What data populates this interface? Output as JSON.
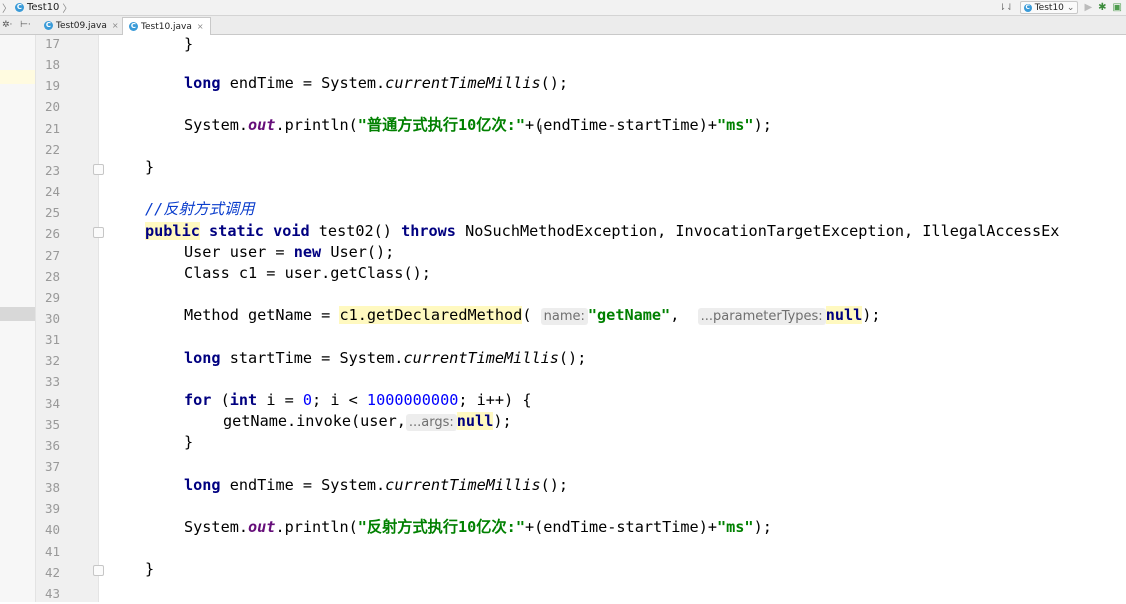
{
  "breadcrumb": {
    "label": "Test10"
  },
  "run_config": {
    "label": "Test10"
  },
  "tabs": [
    {
      "label": "Test09.java",
      "active": false
    },
    {
      "label": "Test10.java",
      "active": true
    }
  ],
  "code": {
    "line_numbers": [
      "17",
      "18",
      "19",
      "20",
      "21",
      "22",
      "23",
      "24",
      "25",
      "26",
      "27",
      "28",
      "29",
      "30",
      "31",
      "32",
      "33",
      "34",
      "35",
      "36",
      "37",
      "38",
      "39",
      "40",
      "41",
      "42",
      "43"
    ],
    "l17": {
      "brace": "}"
    },
    "l19": {
      "type": "long",
      "rest1": " endTime = System.",
      "method": "currentTimeMillis",
      "rest2": "();"
    },
    "l21": {
      "a": "System.",
      "field": "out",
      "b": ".println(",
      "str1": "\"普通方式执行10亿次:\"",
      "c": "+(endTime-startTime)+",
      "str2": "\"ms\"",
      "d": ");"
    },
    "l23": {
      "brace": "}"
    },
    "l25": {
      "slashes": "//",
      "comment": "反射方式调用"
    },
    "l26": {
      "kw1": "public",
      "kw2": "static",
      "kw3": "void",
      "name": " test02() ",
      "kw4": "throws",
      "rest": " NoSuchMethodException, InvocationTargetException, IllegalAccessEx"
    },
    "l27": {
      "a": "User user = ",
      "kw": "new",
      "b": " User();"
    },
    "l28": {
      "text": "Class c1 = user.getClass();"
    },
    "l30": {
      "a": "Method getName = ",
      "call": "c1.getDeclaredMethod",
      "b": "(",
      "hint1": "name:",
      "str": "\"getName\"",
      "c": ", ",
      "hint2": "...parameterTypes:",
      "kwnull": "null",
      "d": ");"
    },
    "l32": {
      "type": "long",
      "rest1": " startTime = System.",
      "method": "currentTimeMillis",
      "rest2": "();"
    },
    "l34": {
      "kw1": "for",
      "a": " (",
      "kw2": "int",
      "b": " i = ",
      "zero": "0",
      "c": "; i < ",
      "big": "1000000000",
      "d": "; i++) {"
    },
    "l35": {
      "a": "getName.invoke(user,",
      "hint": "...args:",
      "kwnull": "null",
      "b": ");"
    },
    "l36": {
      "brace": "}"
    },
    "l38": {
      "type": "long",
      "rest1": " endTime = System.",
      "method": "currentTimeMillis",
      "rest2": "();"
    },
    "l40": {
      "a": "System.",
      "field": "out",
      "b": ".println(",
      "str1": "\"反射方式执行10亿次:\"",
      "c": "+(endTime-startTime)+",
      "str2": "\"ms\"",
      "d": ");"
    },
    "l42": {
      "brace": "}"
    }
  }
}
